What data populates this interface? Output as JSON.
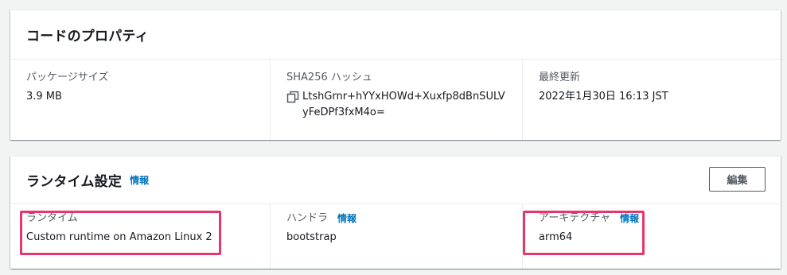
{
  "code_properties": {
    "title": "コードのプロパティ",
    "package_size_label": "パッケージサイズ",
    "package_size_value": "3.9 MB",
    "sha_label": "SHA256 ハッシュ",
    "sha_value": "LtshGrnr+hYYxHOWd+Xuxfp8dBnSULVyFeDPf3fxM4o=",
    "last_modified_label": "最終更新",
    "last_modified_value": "2022年1月30日 16:13 JST"
  },
  "runtime_settings": {
    "title": "ランタイム設定",
    "info_link": "情報",
    "edit_button": "編集",
    "runtime_label": "ランタイム",
    "runtime_value": "Custom runtime on Amazon Linux 2",
    "handler_label": "ハンドラ",
    "handler_info": "情報",
    "handler_value": "bootstrap",
    "architecture_label": "アーキテクチャ",
    "architecture_info": "情報",
    "architecture_value": "arm64"
  },
  "icons": {
    "copy": "copy-icon"
  },
  "colors": {
    "link": "#0073bb",
    "highlight": "#e8366c",
    "label": "#545b64",
    "text": "#16191f"
  }
}
